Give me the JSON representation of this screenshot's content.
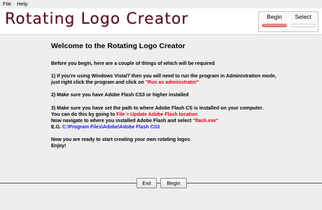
{
  "menu": {
    "file": "File",
    "help": "Help"
  },
  "header": {
    "title": "Rotating Logo Creator",
    "steps": {
      "begin": "Begin",
      "select": "Select"
    }
  },
  "main": {
    "heading": "Welcome to the Rotating Logo Creator",
    "intro": "Before you begin, here are a couple of things of which will be required",
    "item1_line1": "1) If you're using Windows Vista/7 then you will need to run the program in Administration mode,",
    "item1_line2_pre": "just right click the program and click on ",
    "item1_line2_highlight": "\"Run as administrator\"",
    "item2": "2) Make sure you have Adobe Flash CS3 or higher installed",
    "item3_line1": "3) Make sure you have set the path to where Adobe Flash CS is installed on your computer.",
    "item3_line2_pre": "You can do this by going to ",
    "item3_line2_highlight": "File > Update Adobe Flash location",
    "item3_line3_pre": "Now navigate to where you installed Adobe Flash and select ",
    "item3_line3_highlight": "\"flash.exe\"",
    "item3_line4_pre": "E.G. ",
    "item3_line4_highlight": "C:\\Program Files\\Adobe\\Adobe Flash CS3",
    "ready": "Now you are ready to start creating your own rotating logos",
    "enjoy": "Enjoy!"
  },
  "footer": {
    "exit_label": "Exit",
    "begin_label": "Begin"
  },
  "colors": {
    "title": "#5a1020",
    "highlight_red": "#e0001a",
    "highlight_blue": "#1a1aff",
    "progress_active": "#e46a6a"
  }
}
